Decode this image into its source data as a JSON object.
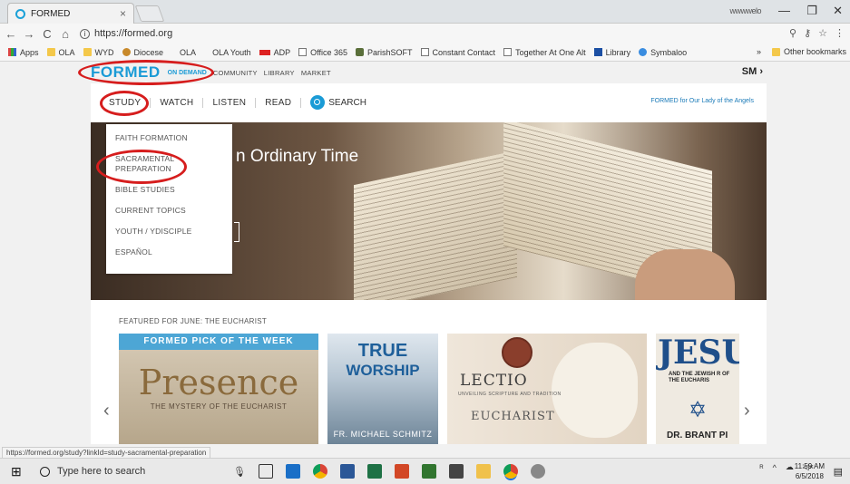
{
  "browser": {
    "tab_title": "FORMED",
    "tab_close": "×",
    "profile": "wwwwelo",
    "window_controls": [
      "—",
      "❐",
      "✕"
    ],
    "url": "https://formed.org",
    "icons": {
      "back": "back-arrow-icon",
      "forward": "forward-arrow-icon",
      "reload": "reload-icon",
      "home": "home-icon",
      "zoom": "zoom-icon",
      "key": "key-icon",
      "star": "star-icon",
      "menu": "menu-icon"
    }
  },
  "bookmarks": {
    "items": [
      "Apps",
      "OLA",
      "WYD",
      "Diocese",
      "OLA",
      "OLA Youth",
      "ADP",
      "Office 365",
      "ParishSOFT",
      "Constant Contact",
      "Together At One Alt",
      "Library",
      "Symbaloo"
    ],
    "overflow": "»",
    "other": "Other bookmarks"
  },
  "site": {
    "logo": "FORMED",
    "top_links": [
      "ON DEMAND",
      "COMMUNITY",
      "LIBRARY",
      "MARKET"
    ],
    "user": "SM ›",
    "sub_links": [
      "STUDY",
      "WATCH",
      "LISTEN",
      "READ"
    ],
    "search_label": "SEARCH",
    "parish": "FORMED for Our Lady of the Angels",
    "hero_title": "n Ordinary Time",
    "dropdown": [
      "FAITH FORMATION",
      "SACRAMENTAL PREPARATION",
      "BIBLE STUDIES",
      "CURRENT TOPICS",
      "YOUTH / YDISCIPLE",
      "ESPAÑOL"
    ],
    "featured_label": "FEATURED FOR JUNE: THE EUCHARIST",
    "cards": {
      "c1_band": "FORMED PICK OF THE WEEK",
      "c1_title": "Presence",
      "c1_sub": "THE MYSTERY OF THE EUCHARIST",
      "c2_t1": "TRUE",
      "c2_t2": "WORSHIP",
      "c2_t3": "FR. MICHAEL SCHMITZ",
      "c3_l1": "LECTIO",
      "c3_l2": "UNVEILING SCRIPTURE AND TRADITION",
      "c3_l3": "EUCHARIST",
      "c4_j1": "JESU",
      "c4_j2": "AND THE JEWISH R OF THE EUCHARIS",
      "c4_j3": "DR. BRANT PI"
    },
    "arrow_left": "‹",
    "arrow_right": "›"
  },
  "statusbar": "https://formed.org/study?linkId=study-sacramental-preparation",
  "taskbar": {
    "search_placeholder": "Type here to search",
    "time": "11:59 AM",
    "date": "6/5/2018"
  },
  "colors": {
    "accent": "#1a9bd6",
    "highlight_ring": "#d61d1d"
  }
}
